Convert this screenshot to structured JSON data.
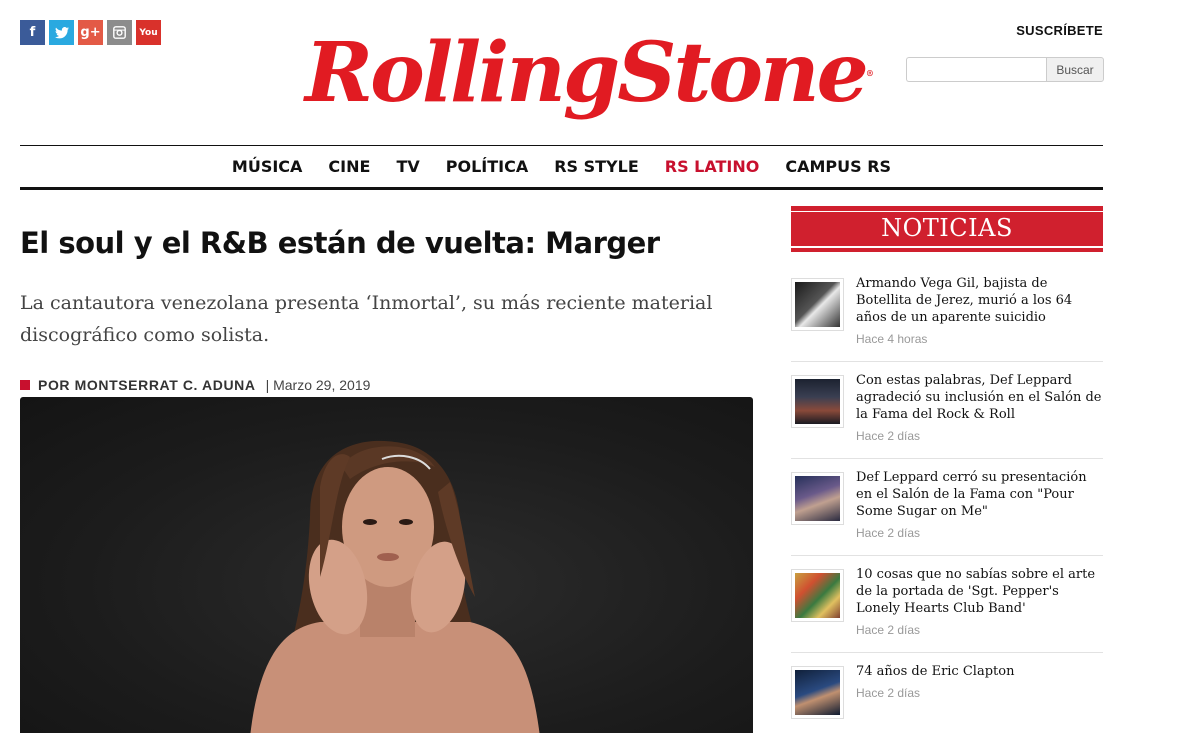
{
  "social": [
    {
      "icon": "facebook-icon",
      "glyph": "f",
      "color": "#3b5b99"
    },
    {
      "icon": "twitter-icon",
      "glyph": "🐦",
      "color": "#2aa9e0"
    },
    {
      "icon": "google-plus-icon",
      "glyph": "g+",
      "color": "#e35a46"
    },
    {
      "icon": "instagram-icon",
      "glyph": "◙",
      "color": "#8c8c8c"
    },
    {
      "icon": "youtube-icon",
      "glyph": "You",
      "color": "#d9312b"
    }
  ],
  "header": {
    "logo": "RollingStone",
    "subscribe": "SUSCRÍBETE",
    "search_placeholder": "",
    "search_button": "Buscar"
  },
  "nav": {
    "items": [
      {
        "label": "MÚSICA"
      },
      {
        "label": "CINE"
      },
      {
        "label": "TV"
      },
      {
        "label": "POLÍTICA"
      },
      {
        "label": "RS STYLE"
      },
      {
        "label": "RS LATINO"
      },
      {
        "label": "CAMPUS RS"
      }
    ],
    "active_index": 5,
    "active_color": "#c8102e"
  },
  "article": {
    "headline": "El soul y el R&B están de vuelta: Marger",
    "dek": "La cantautora venezolana presenta ‘Inmortal’, su más reciente material discográfico como solista.",
    "author": "POR MONTSERRAT C. ADUNA",
    "date": "| Marzo 29, 2019"
  },
  "sidebar": {
    "section_title": "NOTICIAS",
    "accent": "#d0202e",
    "items": [
      {
        "title": "Armando Vega Gil, bajista de Botellita de Jerez, murió a los 64 años de un aparente suicidio",
        "time": "Hace 4 horas"
      },
      {
        "title": "Con estas palabras, Def Leppard agradeció su inclusión en el Salón de la Fama del Rock & Roll",
        "time": "Hace 2 días"
      },
      {
        "title": "Def Leppard cerró su presentación en el Salón de la Fama con \"Pour Some Sugar on Me\"",
        "time": "Hace 2 días"
      },
      {
        "title": "10 cosas que no sabías sobre el arte de la portada de 'Sgt. Pepper's Lonely Hearts Club Band'",
        "time": "Hace 2 días"
      },
      {
        "title": "74 años de Eric Clapton",
        "time": "Hace 2 días"
      }
    ]
  }
}
